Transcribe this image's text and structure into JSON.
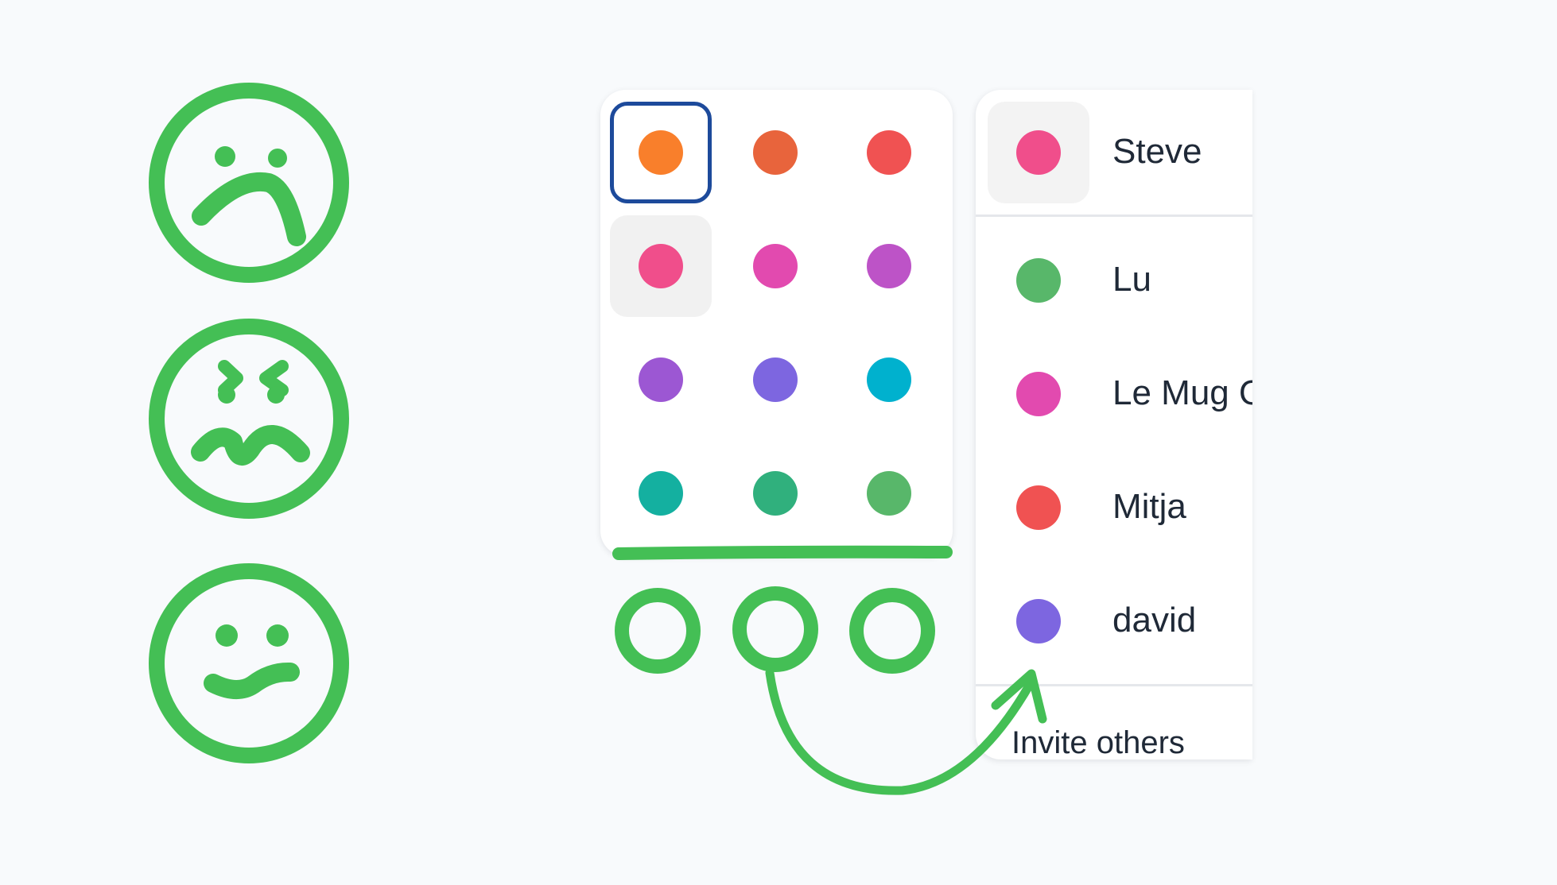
{
  "palette": {
    "swatches": [
      {
        "name": "orange",
        "color": "#f97f2b",
        "selected": true
      },
      {
        "name": "red-orange",
        "color": "#e8643c"
      },
      {
        "name": "red",
        "color": "#f05252"
      },
      {
        "name": "pink",
        "color": "#f04e8b",
        "hovered": true
      },
      {
        "name": "magenta",
        "color": "#e24aaf"
      },
      {
        "name": "orchid",
        "color": "#bd53c7"
      },
      {
        "name": "violet",
        "color": "#9c57d3"
      },
      {
        "name": "indigo",
        "color": "#7d66e0"
      },
      {
        "name": "cyan",
        "color": "#00b1ce"
      },
      {
        "name": "teal",
        "color": "#14b0a0"
      },
      {
        "name": "sea-green",
        "color": "#30b07d"
      },
      {
        "name": "green",
        "color": "#58b76a"
      }
    ]
  },
  "people": [
    {
      "name": "Steve",
      "color": "#f04e8b",
      "current": true
    },
    {
      "name": "Lu",
      "color": "#58b76a"
    },
    {
      "name": "Le Mug O",
      "color": "#e24aaf"
    },
    {
      "name": "Mitja",
      "color": "#f05252"
    },
    {
      "name": "david",
      "color": "#7d66e0"
    }
  ],
  "invite_label": "Invite others",
  "annotation_color": "#44bf55",
  "selection_color": "#1d4a9b",
  "faces": [
    "sad-face-icon",
    "frustrated-face-icon",
    "content-face-icon"
  ]
}
